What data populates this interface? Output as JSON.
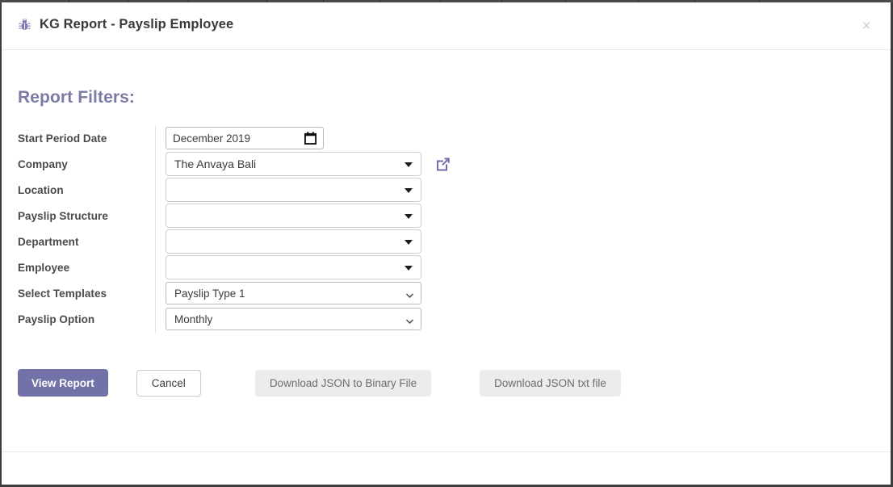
{
  "window": {
    "close_label": "×"
  },
  "header": {
    "icon": "bug-icon",
    "title": "KG Report - Payslip Employee"
  },
  "body": {
    "section_heading": "Report Filters:"
  },
  "filters": {
    "rows": [
      {
        "label": "Start Period Date",
        "control": "date",
        "value": "December  2019",
        "icon": "calendar-icon"
      },
      {
        "label": "Company",
        "control": "material-select",
        "value": "The Anvaya Bali",
        "placeholder": "",
        "action_icon": "external-link-icon"
      },
      {
        "label": "Location",
        "control": "material-select",
        "value": "",
        "placeholder": ""
      },
      {
        "label": "Payslip Structure",
        "control": "material-select",
        "value": "",
        "placeholder": ""
      },
      {
        "label": "Department",
        "control": "material-select",
        "value": "",
        "placeholder": ""
      },
      {
        "label": "Employee",
        "control": "material-select",
        "value": "",
        "placeholder": ""
      },
      {
        "label": "Select Templates",
        "control": "native-select",
        "value": "Payslip Type 1",
        "placeholder": ""
      },
      {
        "label": "Payslip Option",
        "control": "native-select",
        "value": "Monthly",
        "placeholder": ""
      }
    ]
  },
  "actions": {
    "view_report": "View Report",
    "cancel": "Cancel",
    "download_binary": "Download JSON to Binary File",
    "download_txt": "Download JSON txt file"
  },
  "colors": {
    "accent_purple": "#7272a8",
    "heading_purple": "#7b7ba6",
    "muted_button_bg": "#ececec",
    "label_text": "#4a4a4a"
  }
}
